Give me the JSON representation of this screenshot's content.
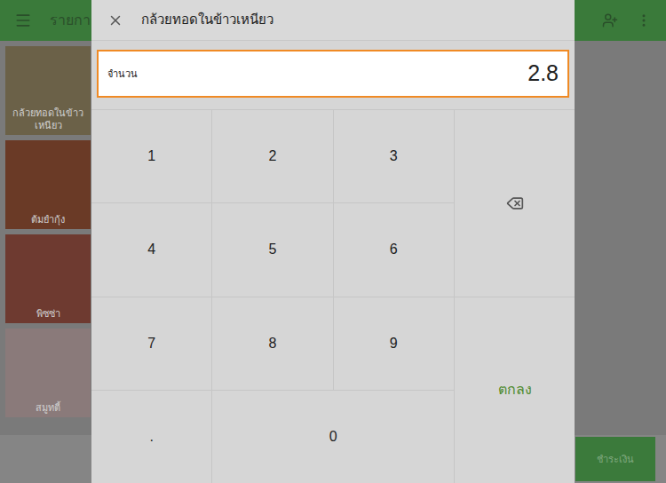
{
  "app": {
    "title": "รายการ",
    "checkout_button": "ชำระเงิน"
  },
  "menu_items": [
    {
      "name": "กล้วยทอดในข้าวเหนียว",
      "color": "#6b6148"
    },
    {
      "name": "ต้มยำกุ้ง",
      "color": "#6a3a26"
    },
    {
      "name": "พิซซ่า",
      "color": "#6e3a30"
    },
    {
      "name": "สมูทตี้",
      "color": "#8a7a7a"
    }
  ],
  "dialog": {
    "title": "กล้วยทอดในข้าวเหนียว",
    "field": {
      "label": "จำนวน",
      "value": "2.8",
      "focused": true
    },
    "keys": [
      {
        "label": "1"
      },
      {
        "label": "2"
      },
      {
        "label": "3"
      },
      {
        "label": "4"
      },
      {
        "label": "5"
      },
      {
        "label": "6"
      },
      {
        "label": "7"
      },
      {
        "label": "8"
      },
      {
        "label": "9"
      },
      {
        "label": "."
      },
      {
        "label": "0"
      }
    ],
    "actions": [
      {
        "kind": "backspace",
        "label": ""
      },
      {
        "kind": "confirm",
        "label": "ตกลง"
      }
    ]
  }
}
